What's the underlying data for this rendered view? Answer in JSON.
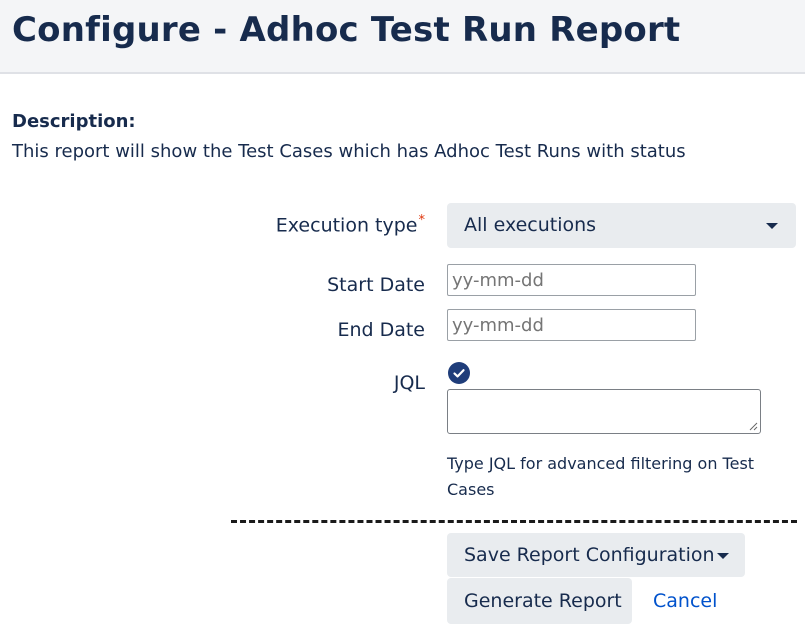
{
  "header": {
    "title": "Configure - Adhoc Test Run Report"
  },
  "description": {
    "label": "Description:",
    "text": "This report will show the Test Cases which has Adhoc Test Runs with status"
  },
  "form": {
    "execution_type": {
      "label": "Execution type",
      "required_mark": "*",
      "selected": "All executions"
    },
    "start_date": {
      "label": "Start Date",
      "placeholder": "yy-mm-dd"
    },
    "end_date": {
      "label": "End Date",
      "placeholder": "yy-mm-dd"
    },
    "jql": {
      "label": "JQL",
      "value": "",
      "help": "Type JQL for advanced filtering on Test Cases",
      "status_icon": "check-circle-icon"
    }
  },
  "actions": {
    "save_label": "Save Report Configuration",
    "generate_label": "Generate Report",
    "cancel_label": "Cancel"
  },
  "colors": {
    "header_bg": "#f4f5f7",
    "text": "#172b4d",
    "button_bg": "#e9ecef",
    "link": "#0052cc",
    "required": "#de350b",
    "check_icon": "#1f3d7a"
  }
}
